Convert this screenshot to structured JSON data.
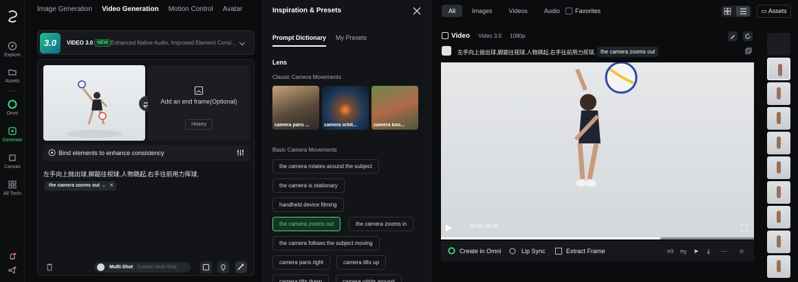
{
  "rail": {
    "items": [
      {
        "label": "Explore",
        "icon": "compass-icon"
      },
      {
        "label": "Assets",
        "icon": "folder-icon"
      },
      {
        "label": "Omni",
        "icon": "omni-icon"
      },
      {
        "label": "Generate",
        "icon": "generate-icon",
        "active": true
      },
      {
        "label": "Canvas",
        "icon": "canvas-icon"
      },
      {
        "label": "All Tools",
        "icon": "grid-icon"
      }
    ]
  },
  "top_tabs": [
    "Image Generation",
    "Video Generation",
    "Motion Control",
    "Avatar"
  ],
  "model": {
    "thumb": "3.0",
    "name": "VIDEO 3.0",
    "badge": "NEW",
    "desc": "Enhanced Native Audio, Improved Element Consisten..."
  },
  "frames": {
    "add_end": "Add an end frame(Optional)",
    "history": "History",
    "bind": "Bind elements to enhance consistency",
    "prompt": "左手向上抛出球,脚踮往视球,人物跳起,右手往前用力挥球,",
    "chip": "the camera zooms out",
    "multishot": "Multi-Shot",
    "custom": "Custom Multi-Shot"
  },
  "inspiration": {
    "title": "Inspiration & Presets",
    "tabs": [
      "Prompt Dictionary",
      "My Presets"
    ],
    "lens": "Lens",
    "classic": "Classic Camera Movements",
    "cards": [
      "camera pans ...",
      "camera orbit...",
      "camera boo..."
    ],
    "basic": "Basic Camera Movements",
    "pills": [
      "the camera rotates around the subject",
      "the camera is stationary",
      "handheld device filming",
      "the camera zooms out",
      "the camera zooms in",
      "the camera follows the subject moving",
      "camera pans right",
      "camera tilts up",
      "camera tilts down",
      "camera orbits around"
    ],
    "selected_pill": "the camera zooms out"
  },
  "right": {
    "filters": [
      "All",
      "Images",
      "Videos",
      "Audio"
    ],
    "favorites": "Favorites",
    "assets": "Assets",
    "video_label": "Video",
    "model": "Video 3.0",
    "resolution": "1080p",
    "prompt": "左手向上抛出球,脚踮往视球,人物跳起,右手往前用力挥球,",
    "tag": "the camera zooms out",
    "time": "00:04 / 00:05",
    "progress": 0.7,
    "actions": [
      "Create in Omni",
      "Lip Sync",
      "Extract Frame"
    ]
  },
  "colors": {
    "accent": "#3ddc84",
    "bg": "#0b0c0e",
    "panel": "#121417"
  }
}
